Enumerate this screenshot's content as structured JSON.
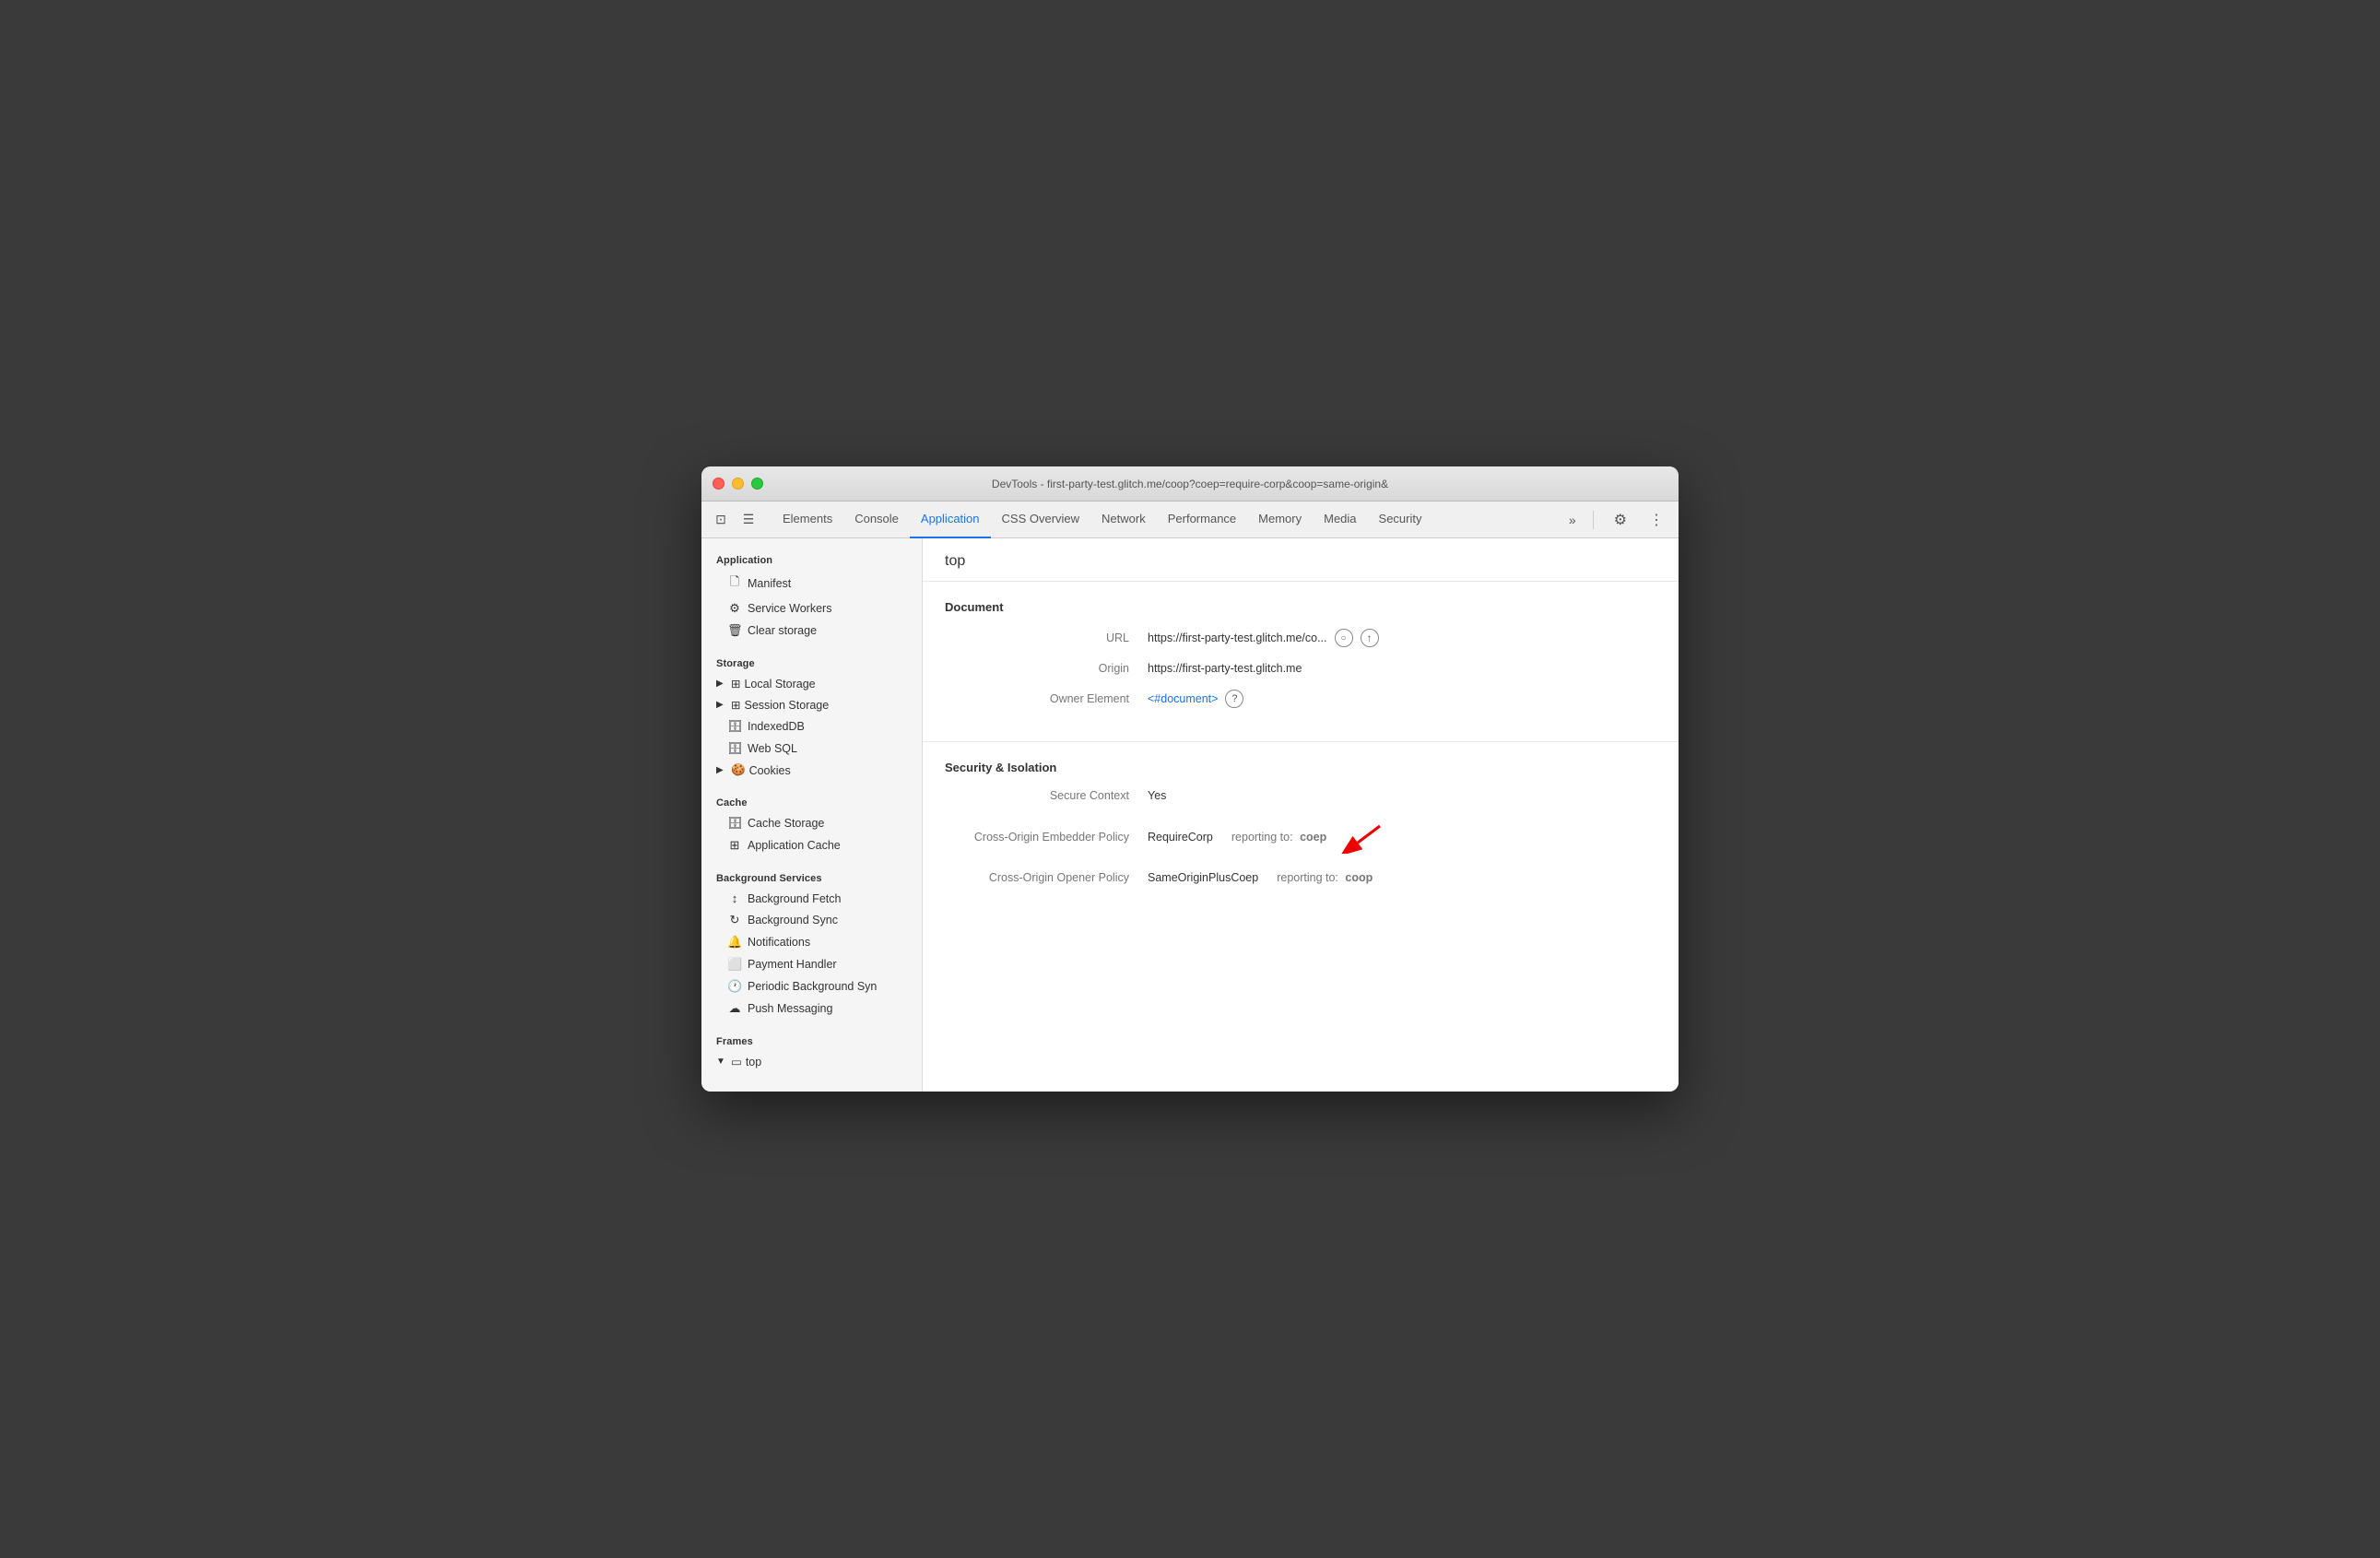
{
  "window": {
    "title": "DevTools - first-party-test.glitch.me/coop?coep=require-corp&coop=same-origin&"
  },
  "tabs": [
    {
      "label": "Elements",
      "active": false
    },
    {
      "label": "Console",
      "active": false
    },
    {
      "label": "Application",
      "active": true
    },
    {
      "label": "CSS Overview",
      "active": false
    },
    {
      "label": "Network",
      "active": false
    },
    {
      "label": "Performance",
      "active": false
    },
    {
      "label": "Memory",
      "active": false
    },
    {
      "label": "Media",
      "active": false
    },
    {
      "label": "Security",
      "active": false
    }
  ],
  "sidebar": {
    "application_section": "Application",
    "manifest_label": "Manifest",
    "service_workers_label": "Service Workers",
    "clear_storage_label": "Clear storage",
    "storage_section": "Storage",
    "local_storage_label": "Local Storage",
    "session_storage_label": "Session Storage",
    "indexeddb_label": "IndexedDB",
    "web_sql_label": "Web SQL",
    "cookies_label": "Cookies",
    "cache_section": "Cache",
    "cache_storage_label": "Cache Storage",
    "application_cache_label": "Application Cache",
    "background_services_section": "Background Services",
    "background_fetch_label": "Background Fetch",
    "background_sync_label": "Background Sync",
    "notifications_label": "Notifications",
    "payment_handler_label": "Payment Handler",
    "periodic_background_sync_label": "Periodic Background Syn",
    "push_messaging_label": "Push Messaging",
    "frames_section": "Frames",
    "top_frame_label": "top"
  },
  "content": {
    "page_title": "top",
    "document_section_title": "Document",
    "url_label": "URL",
    "url_value": "https://first-party-test.glitch.me/co...",
    "origin_label": "Origin",
    "origin_value": "https://first-party-test.glitch.me",
    "owner_element_label": "Owner Element",
    "owner_element_value": "<#document>",
    "security_section_title": "Security & Isolation",
    "secure_context_label": "Secure Context",
    "secure_context_value": "Yes",
    "coep_label": "Cross-Origin Embedder Policy",
    "coep_value": "RequireCorp",
    "coep_reporting": "reporting to:",
    "coep_endpoint": "coep",
    "coop_label": "Cross-Origin Opener Policy",
    "coop_value": "SameOriginPlusCoep",
    "coop_reporting": "reporting to:",
    "coop_endpoint": "coop"
  }
}
